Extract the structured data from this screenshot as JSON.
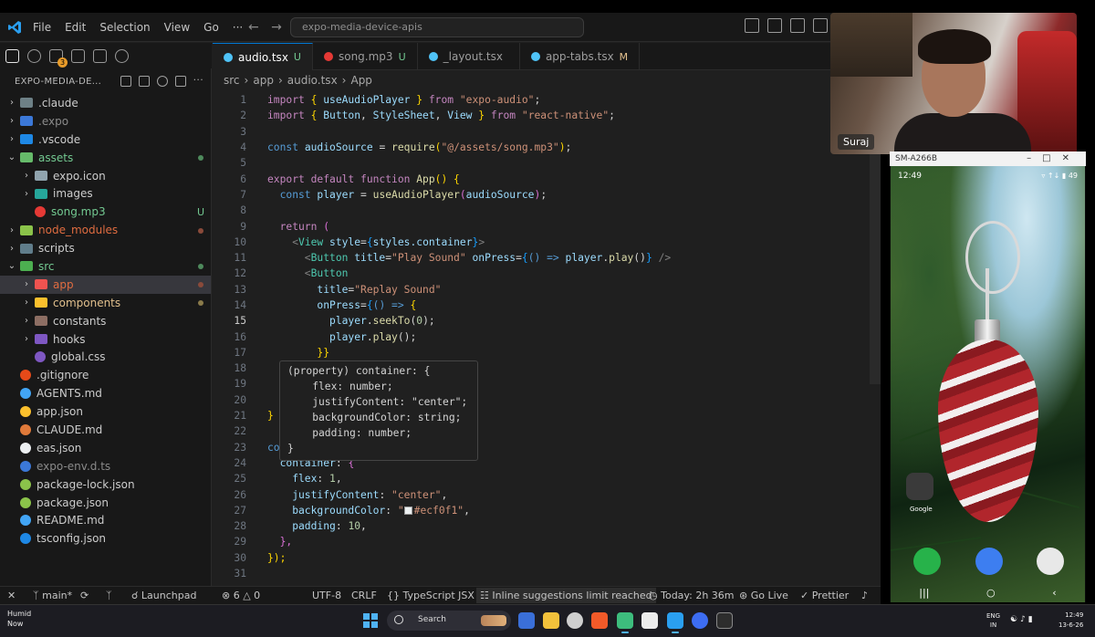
{
  "titlebar": {
    "menu": [
      "File",
      "Edit",
      "Selection",
      "View",
      "Go",
      "···"
    ],
    "search": "expo-media-device-apis"
  },
  "activity_bar": {
    "badge": "3"
  },
  "explorer": {
    "title": "EXPO-MEDIA-DE...",
    "items": [
      {
        "label": ".claude",
        "kind": "folder",
        "indent": 0,
        "chev": "›",
        "color": "#cccccc",
        "icon": "#6d8086",
        "status": ""
      },
      {
        "label": ".expo",
        "kind": "folder",
        "indent": 0,
        "chev": "›",
        "color": "#8a8a8a",
        "icon": "#3b78d8",
        "status": ""
      },
      {
        "label": ".vscode",
        "kind": "folder",
        "indent": 0,
        "chev": "›",
        "color": "#cccccc",
        "icon": "#1e88e5",
        "status": ""
      },
      {
        "label": "assets",
        "kind": "folder",
        "indent": 0,
        "chev": "⌄",
        "color": "#73c991",
        "icon": "#66bb6a",
        "status": "dot-green"
      },
      {
        "label": "expo.icon",
        "kind": "folder",
        "indent": 1,
        "chev": "›",
        "color": "#cccccc",
        "icon": "#90a4ae",
        "status": ""
      },
      {
        "label": "images",
        "kind": "folder",
        "indent": 1,
        "chev": "›",
        "color": "#cccccc",
        "icon": "#26a69a",
        "status": ""
      },
      {
        "label": "song.mp3",
        "kind": "file",
        "indent": 1,
        "chev": "",
        "color": "#73c991",
        "icon": "#e53935",
        "status": "U"
      },
      {
        "label": "node_modules",
        "kind": "folder",
        "indent": 0,
        "chev": "›",
        "color": "#e06c40",
        "icon": "#8bc34a",
        "status": "dot-red"
      },
      {
        "label": "scripts",
        "kind": "folder",
        "indent": 0,
        "chev": "›",
        "color": "#cccccc",
        "icon": "#607d8b",
        "status": ""
      },
      {
        "label": "src",
        "kind": "folder",
        "indent": 0,
        "chev": "⌄",
        "color": "#73c991",
        "icon": "#4caf50",
        "status": "dot-green"
      },
      {
        "label": "app",
        "kind": "folder",
        "indent": 1,
        "chev": "›",
        "color": "#e06c40",
        "icon": "#ef5350",
        "status": "dot-red",
        "selected": true
      },
      {
        "label": "components",
        "kind": "folder",
        "indent": 1,
        "chev": "›",
        "color": "#e2c08d",
        "icon": "#fbc02d",
        "status": "dot-amber"
      },
      {
        "label": "constants",
        "kind": "folder",
        "indent": 1,
        "chev": "›",
        "color": "#cccccc",
        "icon": "#8d6e63",
        "status": ""
      },
      {
        "label": "hooks",
        "kind": "folder",
        "indent": 1,
        "chev": "›",
        "color": "#cccccc",
        "icon": "#7e57c2",
        "status": ""
      },
      {
        "label": "global.css",
        "kind": "file",
        "indent": 1,
        "chev": "",
        "color": "#cccccc",
        "icon": "#7e57c2",
        "status": ""
      },
      {
        "label": ".gitignore",
        "kind": "file",
        "indent": 0,
        "chev": "",
        "color": "#cccccc",
        "icon": "#e64a19",
        "status": ""
      },
      {
        "label": "AGENTS.md",
        "kind": "file",
        "indent": 0,
        "chev": "",
        "color": "#cccccc",
        "icon": "#42a5f5",
        "status": ""
      },
      {
        "label": "app.json",
        "kind": "file",
        "indent": 0,
        "chev": "",
        "color": "#cccccc",
        "icon": "#fbc02d",
        "status": ""
      },
      {
        "label": "CLAUDE.md",
        "kind": "file",
        "indent": 0,
        "chev": "",
        "color": "#cccccc",
        "icon": "#e07a3a",
        "status": ""
      },
      {
        "label": "eas.json",
        "kind": "file",
        "indent": 0,
        "chev": "",
        "color": "#cccccc",
        "icon": "#eceff1",
        "status": ""
      },
      {
        "label": "expo-env.d.ts",
        "kind": "file",
        "indent": 0,
        "chev": "",
        "color": "#8a8a8a",
        "icon": "#3b78d8",
        "status": ""
      },
      {
        "label": "package-lock.json",
        "kind": "file",
        "indent": 0,
        "chev": "",
        "color": "#cccccc",
        "icon": "#8bc34a",
        "status": ""
      },
      {
        "label": "package.json",
        "kind": "file",
        "indent": 0,
        "chev": "",
        "color": "#cccccc",
        "icon": "#8bc34a",
        "status": ""
      },
      {
        "label": "README.md",
        "kind": "file",
        "indent": 0,
        "chev": "",
        "color": "#cccccc",
        "icon": "#42a5f5",
        "status": ""
      },
      {
        "label": "tsconfig.json",
        "kind": "file",
        "indent": 0,
        "chev": "",
        "color": "#cccccc",
        "icon": "#1e88e5",
        "status": ""
      }
    ]
  },
  "tabs": [
    {
      "label": "audio.tsx",
      "mark": "U",
      "icon": "#4fc3f7",
      "active": true
    },
    {
      "label": "song.mp3",
      "mark": "U",
      "icon": "#e53935",
      "active": false
    },
    {
      "label": "_layout.tsx",
      "mark": "",
      "icon": "#4fc3f7",
      "active": false
    },
    {
      "label": "app-tabs.tsx",
      "mark": "M",
      "icon": "#4fc3f7",
      "active": false
    }
  ],
  "breadcrumb": [
    "src",
    "app",
    "audio.tsx",
    "App"
  ],
  "code": {
    "current_line": 15,
    "lines": [
      [
        [
          "import ",
          "t-kw"
        ],
        [
          "{ ",
          "t-br1"
        ],
        [
          "useAudioPlayer",
          "t-var"
        ],
        [
          " }",
          "t-br1"
        ],
        [
          " from ",
          "t-kw"
        ],
        [
          "\"expo-audio\"",
          "t-str"
        ],
        [
          ";",
          ""
        ]
      ],
      [
        [
          "import ",
          "t-kw"
        ],
        [
          "{ ",
          "t-br1"
        ],
        [
          "Button",
          "t-var"
        ],
        [
          ", ",
          ""
        ],
        [
          "StyleSheet",
          "t-var"
        ],
        [
          ", ",
          ""
        ],
        [
          "View",
          "t-var"
        ],
        [
          " }",
          "t-br1"
        ],
        [
          " from ",
          "t-kw"
        ],
        [
          "\"react-native\"",
          "t-str"
        ],
        [
          ";",
          ""
        ]
      ],
      [],
      [
        [
          "const ",
          "t-kw2"
        ],
        [
          "audioSource",
          "t-var"
        ],
        [
          " = ",
          ""
        ],
        [
          "require",
          "t-fn"
        ],
        [
          "(",
          "t-br1"
        ],
        [
          "\"@/assets/song.mp3\"",
          "t-str"
        ],
        [
          ")",
          "t-br1"
        ],
        [
          ";",
          ""
        ]
      ],
      [],
      [
        [
          "export default function ",
          "t-kw"
        ],
        [
          "App",
          "t-fn"
        ],
        [
          "() ",
          "t-br1"
        ],
        [
          "{",
          "t-br1"
        ]
      ],
      [
        [
          "  const ",
          "t-kw2"
        ],
        [
          "player",
          "t-var"
        ],
        [
          " = ",
          ""
        ],
        [
          "useAudioPlayer",
          "t-fn"
        ],
        [
          "(",
          "t-br2"
        ],
        [
          "audioSource",
          "t-var"
        ],
        [
          ")",
          "t-br2"
        ],
        [
          ";",
          ""
        ]
      ],
      [],
      [
        [
          "  return ",
          "t-kw"
        ],
        [
          "(",
          "t-br2"
        ]
      ],
      [
        [
          "    <",
          "t-pun"
        ],
        [
          "View ",
          "t-tag"
        ],
        [
          "style",
          "t-var"
        ],
        [
          "=",
          ""
        ],
        [
          "{",
          "t-br3"
        ],
        [
          "styles.container",
          "t-var"
        ],
        [
          "}",
          "t-br3"
        ],
        [
          ">",
          "t-pun"
        ]
      ],
      [
        [
          "      <",
          "t-pun"
        ],
        [
          "Button ",
          "t-tag"
        ],
        [
          "title",
          "t-var"
        ],
        [
          "=",
          ""
        ],
        [
          "\"Play Sound\"",
          "t-str"
        ],
        [
          " onPress",
          "t-var"
        ],
        [
          "=",
          ""
        ],
        [
          "{",
          "t-br3"
        ],
        [
          "() => ",
          "t-kw2"
        ],
        [
          "player",
          "t-var"
        ],
        [
          ".",
          ""
        ],
        [
          "play",
          "t-fn"
        ],
        [
          "()",
          ""
        ],
        [
          "}",
          "t-br3"
        ],
        [
          " />",
          "t-pun"
        ]
      ],
      [
        [
          "      <",
          "t-pun"
        ],
        [
          "Button",
          "t-tag"
        ]
      ],
      [
        [
          "        title",
          "t-var"
        ],
        [
          "=",
          ""
        ],
        [
          "\"Replay Sound\"",
          "t-str"
        ]
      ],
      [
        [
          "        onPress",
          "t-var"
        ],
        [
          "=",
          ""
        ],
        [
          "{",
          "t-br3"
        ],
        [
          "() => ",
          "t-kw2"
        ],
        [
          "{",
          "t-br1"
        ]
      ],
      [
        [
          "          player",
          "t-var"
        ],
        [
          ".",
          ""
        ],
        [
          "seekTo",
          "t-fn"
        ],
        [
          "(",
          ""
        ],
        [
          "0",
          "t-num"
        ],
        [
          ");",
          ""
        ]
      ],
      [
        [
          "          player",
          "t-var"
        ],
        [
          ".",
          ""
        ],
        [
          "play",
          "t-fn"
        ],
        [
          "();",
          ""
        ]
      ],
      [
        [
          "        }}",
          "t-br1"
        ]
      ],
      [],
      [],
      [],
      [
        [
          "}",
          "t-br1"
        ]
      ],
      [],
      [
        [
          "co",
          "t-kw2"
        ],
        [
          "                          [",
          "t-br1"
        ]
      ],
      [
        [
          "  container",
          "t-var"
        ],
        [
          ": ",
          ""
        ],
        [
          "{",
          "t-br2"
        ]
      ],
      [
        [
          "    flex",
          "t-var"
        ],
        [
          ": ",
          ""
        ],
        [
          "1",
          "t-num"
        ],
        [
          ",",
          ""
        ]
      ],
      [
        [
          "    justifyContent",
          "t-var"
        ],
        [
          ": ",
          ""
        ],
        [
          "\"center\"",
          "t-str"
        ],
        [
          ",",
          ""
        ]
      ],
      [
        [
          "    backgroundColor",
          "t-var"
        ],
        [
          ": ",
          ""
        ],
        [
          "\"",
          "t-str"
        ],
        [
          "SWATCH",
          ""
        ],
        [
          "#ecf0f1\"",
          "t-str"
        ],
        [
          ",",
          ""
        ]
      ],
      [
        [
          "    padding",
          "t-var"
        ],
        [
          ": ",
          ""
        ],
        [
          "10",
          "t-num"
        ],
        [
          ",",
          ""
        ]
      ],
      [
        [
          "  },",
          "t-br2"
        ]
      ],
      [
        [
          "});",
          "t-br1"
        ]
      ],
      []
    ]
  },
  "hover": [
    "(property) container: {",
    "    flex: number;",
    "    justifyContent: \"center\";",
    "    backgroundColor: string;",
    "    padding: number;",
    "}"
  ],
  "statusbar": {
    "branch": "main*",
    "launchpad": "Launchpad",
    "problems": "6",
    "warnings": "0",
    "encoding": "UTF-8",
    "eol": "CRLF",
    "language": "TypeScript JSX",
    "inline": "Inline suggestions limit reached",
    "today": "Today: 2h 36m",
    "golive": "Go Live",
    "prettier": "Prettier"
  },
  "webcam": {
    "name": "Suraj"
  },
  "phone": {
    "window_title": "SM-A266B",
    "clock": "12:49",
    "status_right": "▿ ↑↓ ▮ 49",
    "folder_label": "Google"
  },
  "taskbar": {
    "weather_title": "Humid",
    "weather_sub": "Now",
    "search": "Search",
    "lang": "ENG",
    "lang_sub": "IN",
    "time": "12:49",
    "date": "13-6-26"
  }
}
